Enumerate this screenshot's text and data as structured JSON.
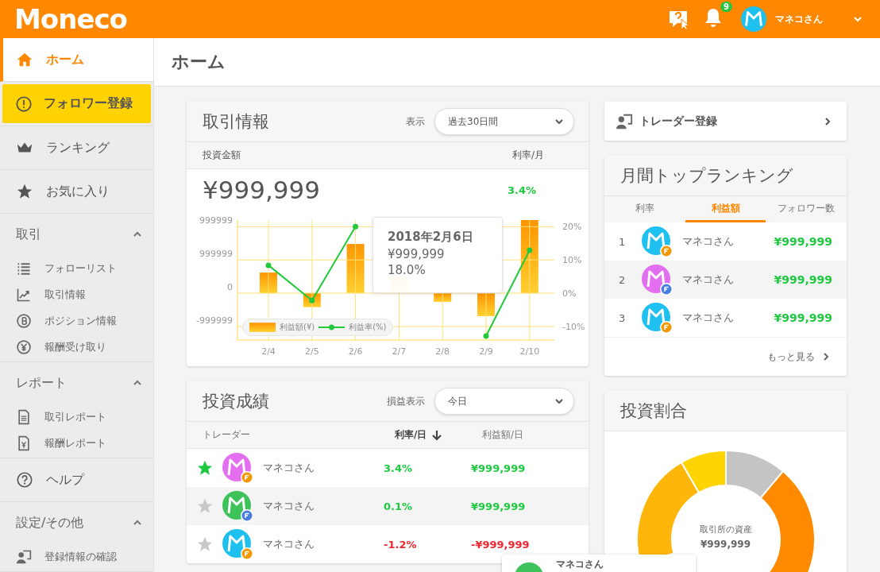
{
  "header": {
    "logo": "Moneco",
    "notifications": "9",
    "user": "マネコさん"
  },
  "sidebar": [
    {
      "kind": "link",
      "label": "ホーム",
      "selected": true
    },
    {
      "kind": "cta",
      "label": "フォロワー登録",
      "selected": false
    },
    {
      "kind": "link",
      "label": "ランキング",
      "selected": false
    },
    {
      "kind": "link",
      "label": "お気に入り",
      "selected": false
    },
    {
      "kind": "section",
      "label": "取引",
      "expanded": true,
      "children": [
        {
          "label": "フォローリスト"
        },
        {
          "label": "取引情報"
        },
        {
          "label": "ポジション情報"
        },
        {
          "label": "報酬受け取り"
        }
      ]
    },
    {
      "kind": "section",
      "label": "レポート",
      "expanded": true,
      "children": [
        {
          "label": "取引レポート"
        },
        {
          "label": "報酬レポート"
        }
      ]
    },
    {
      "kind": "link",
      "label": "ヘルプ",
      "selected": false
    },
    {
      "kind": "section",
      "label": "設定/その他",
      "expanded": true,
      "children": [
        {
          "label": "登録情報の確認"
        }
      ]
    }
  ],
  "page_title": "ホーム",
  "trading": {
    "title": "取引情報",
    "filter_label": "表示",
    "filter_value": "過去30日間",
    "amount_label": "投資金額",
    "rate_label": "利率/月",
    "amount": "¥999,999",
    "rate": "3.4%",
    "y_axis_labels": [
      "999999",
      "999999",
      "0",
      "-999999"
    ],
    "bar_legend": "利益額(¥)",
    "chart_data": {
      "type": "line",
      "grid": true,
      "categories": [
        "2/4",
        "2/5",
        "2/6",
        "2/7",
        "2/8",
        "2/9",
        "2/10"
      ],
      "ylim": [
        -14.1,
        22
      ],
      "yticks": [
        {
          "value": 20,
          "label": "20%"
        },
        {
          "value": 10,
          "label": "10%"
        },
        {
          "value": 0,
          "label": "0%"
        },
        {
          "value": -10,
          "label": "-10%"
        }
      ],
      "series": [
        {
          "name": "利益率(%)",
          "color": "#22c93a",
          "marker": true,
          "values": [
            8.4,
            -2.2,
            20,
            null,
            null,
            -12.9,
            12.9
          ]
        }
      ]
    },
    "tooltip": {
      "title": "2018年2月6日",
      "amount": "¥999,999",
      "rate": "18.0%"
    }
  },
  "performance": {
    "title": "投資成績",
    "filter_label": "損益表示",
    "filter_value": "今日",
    "columns": [
      {
        "label": "トレーダー",
        "sorted": false
      },
      {
        "label": "利率/日",
        "sorted": true
      },
      {
        "label": "利益額/日",
        "sorted": false
      }
    ],
    "rows": [
      {
        "favorite": true,
        "color": "#e36ff0",
        "badge": {
          "color": "#f39800"
        },
        "name": "マネコさん",
        "rate": "3.4%",
        "profit": "¥999,999",
        "kind": "gain"
      },
      {
        "favorite": false,
        "color": "#3ec25a",
        "badge": {
          "color": "#4a7de0"
        },
        "name": "マネコさん",
        "rate": "0.1%",
        "profit": "¥999,999",
        "kind": "gain"
      },
      {
        "favorite": false,
        "color": "#1ec0f0",
        "badge": {
          "color": "#f39800"
        },
        "name": "マネコさん",
        "rate": "-1.2%",
        "profit": "-¥999,999",
        "kind": "loss"
      }
    ]
  },
  "trader_register": {
    "label": "トレーダー登録"
  },
  "ranking": {
    "title": "月間トップランキング",
    "tabs": [
      {
        "label": "利率",
        "selected": false
      },
      {
        "label": "利益額",
        "selected": true
      },
      {
        "label": "フォロワー数",
        "selected": false
      }
    ],
    "rows": [
      {
        "rank": "1",
        "color": "#1ec0f0",
        "badge": {
          "color": "#f39800"
        },
        "name": "マネコさん",
        "value": "¥999,999"
      },
      {
        "rank": "2",
        "color": "#e36ff0",
        "badge": {
          "color": "#4a7de0"
        },
        "name": "マネコさん",
        "value": "¥999,999"
      },
      {
        "rank": "3",
        "color": "#1ec0f0",
        "badge": {
          "color": "#f39800"
        },
        "name": "マネコさん",
        "value": "¥999,999"
      }
    ],
    "more": "もっと見る"
  },
  "allocation": {
    "title": "投資割合",
    "center_label": "取引所の資産",
    "center_value": "¥999,999"
  },
  "popup": {
    "color": "#3ec25a",
    "name": "マネコさん"
  }
}
